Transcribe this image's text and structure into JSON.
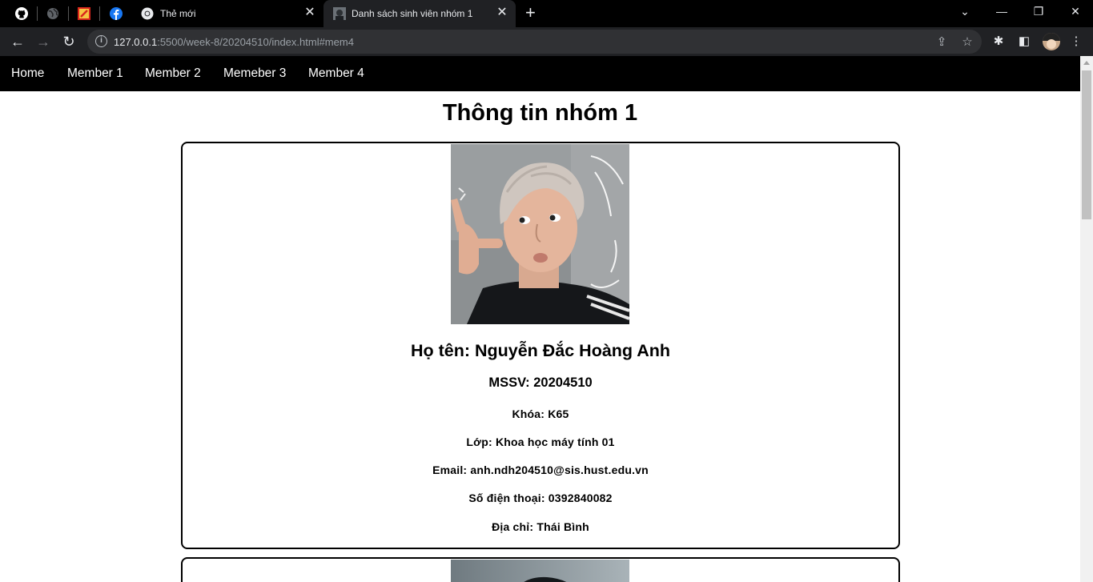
{
  "browser": {
    "tabs": [
      {
        "title": "Thẻ mới",
        "icon": "chrome-icon"
      },
      {
        "title": "Danh sách sinh viên nhóm 1",
        "icon": "page-favicon"
      }
    ],
    "pinned_icons": [
      "github-icon",
      "globe-icon",
      "bookmark-app-icon",
      "facebook-icon"
    ],
    "url_host": "127.0.0.1",
    "url_path": ":5500/week-8/20204510/index.html#mem4"
  },
  "nav": {
    "items": [
      "Home",
      "Member 1",
      "Member 2",
      "Memeber 3",
      "Member 4"
    ]
  },
  "page": {
    "title": "Thông tin nhóm 1"
  },
  "members": [
    {
      "name": "Họ tên: Nguyễn Đắc Hoàng Anh",
      "mssv": "MSSV: 20204510",
      "khoa": "Khóa: K65",
      "lop": "Lớp: Khoa học máy tính 01",
      "email": "Email: anh.ndh204510@sis.hust.edu.vn",
      "phone": "Số điện thoại: 0392840082",
      "address": "Địa chỉ: Thái Bình"
    }
  ]
}
